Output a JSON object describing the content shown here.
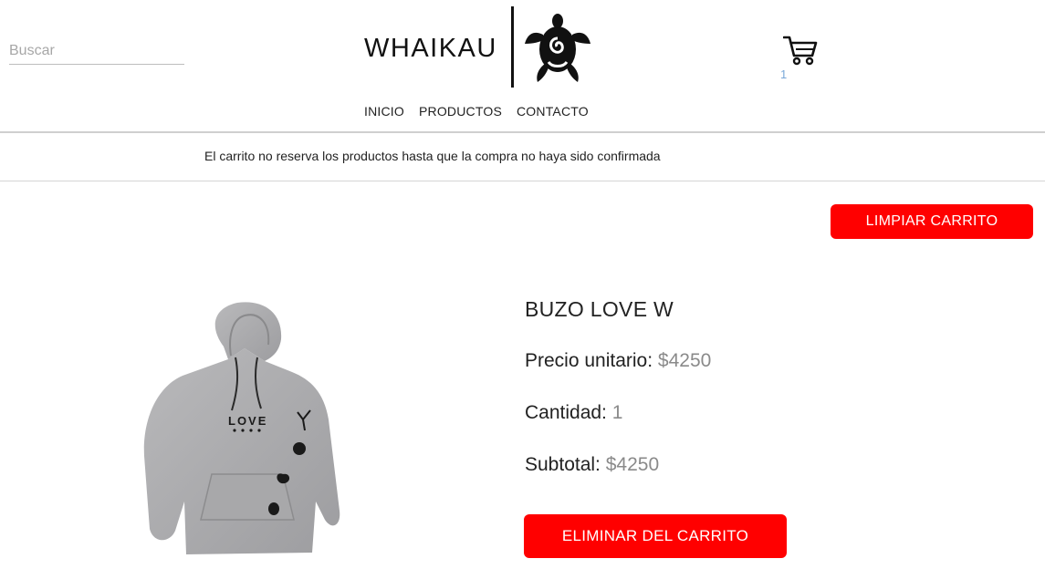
{
  "search": {
    "placeholder": "Buscar"
  },
  "brand": {
    "name": "WHAIKAU"
  },
  "cart": {
    "count": "1"
  },
  "nav": {
    "items": [
      "INICIO",
      "PRODUCTOS",
      "CONTACTO"
    ]
  },
  "notice": {
    "text": "El carrito no reserva los productos hasta que la compra no haya sido confirmada"
  },
  "actions": {
    "clear_label": "LIMPIAR CARRITO",
    "remove_label": "ELIMINAR DEL CARRITO"
  },
  "product": {
    "name": "BUZO LOVE W",
    "price_label": "Precio unitario:",
    "price_value": "$4250",
    "qty_label": "Cantidad:",
    "qty_value": "1",
    "subtotal_label": "Subtotal:",
    "subtotal_value": "$4250",
    "print_text": "LOVE"
  },
  "colors": {
    "accent": "#ff0000",
    "text": "#222222",
    "muted": "#8a8a8a",
    "divider": "#cfcfcf"
  },
  "icons": {
    "cart": "cart-icon",
    "logo": "turtle-logo-icon"
  }
}
